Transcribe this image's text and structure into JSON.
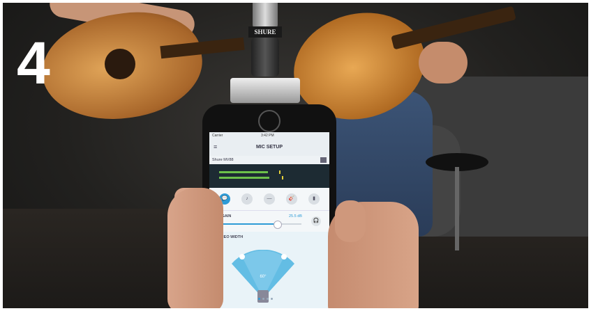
{
  "step_number": "4",
  "mic_brand": "SHURE",
  "phone": {
    "status": {
      "carrier": "Carrier",
      "time": "3:42 PM"
    },
    "nav_title": "MIC SETUP",
    "device_name": "Shure MV88",
    "modes": [
      {
        "icon": "speech-icon",
        "glyph": "💬",
        "active": true
      },
      {
        "icon": "singing-icon",
        "glyph": "♪",
        "active": false
      },
      {
        "icon": "flat-icon",
        "glyph": "—",
        "active": false
      },
      {
        "icon": "guitar-icon",
        "glyph": "🎸",
        "active": false
      },
      {
        "icon": "loud-icon",
        "glyph": "▮",
        "active": false
      }
    ],
    "mic_gain": {
      "label": "MIC GAIN",
      "value": "25.5 dB",
      "level": 0.72
    },
    "stereo_width": {
      "label": "STEREO WIDTH",
      "angle": "60°",
      "page_dots": 4,
      "active_dot": 0
    }
  },
  "colors": {
    "accent": "#2e9bd6",
    "meter_green": "#6cc04a",
    "meter_yellow": "#e8d23a"
  }
}
